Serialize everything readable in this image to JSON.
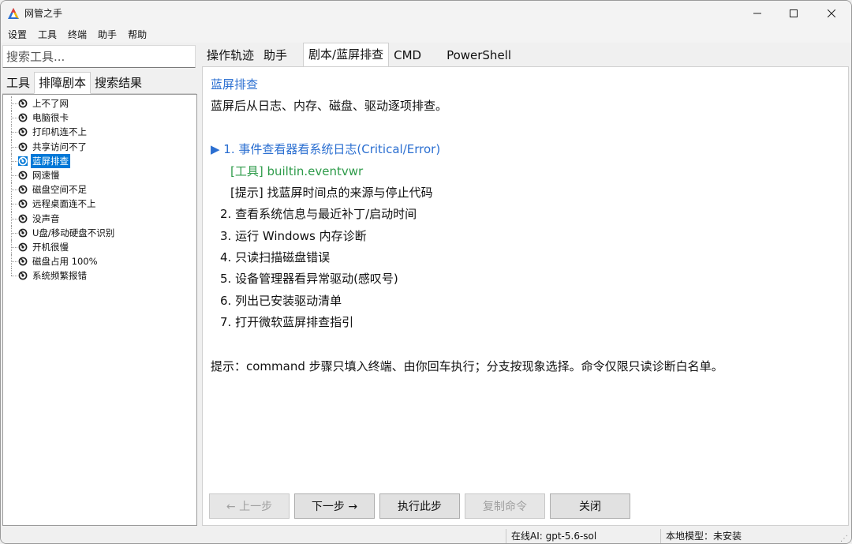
{
  "window": {
    "title": "网管之手",
    "brand_colors": {
      "icon_top": "#e03c3c",
      "icon_left": "#2b6fd1",
      "icon_right": "#f2b705"
    }
  },
  "menubar": {
    "items": [
      "设置",
      "工具",
      "终端",
      "助手",
      "帮助"
    ]
  },
  "left": {
    "search_placeholder": "搜索工具...",
    "tabs": [
      "工具",
      "排障剧本",
      "搜索结果"
    ],
    "active_tab": "排障剧本",
    "tree_items": [
      "上不了网",
      "电脑很卡",
      "打印机连不上",
      "共享访问不了",
      "蓝屏排查",
      "网速慢",
      "磁盘空间不足",
      "远程桌面连不上",
      "没声音",
      "U盘/移动硬盘不识别",
      "开机很慢",
      "磁盘占用 100%",
      "系统频繁报错"
    ],
    "selected_item": "蓝屏排查"
  },
  "right": {
    "tabs": [
      "操作轨迹",
      "助手",
      "剧本/蓝屏排查",
      "CMD",
      "PowerShell"
    ],
    "active_tab": "剧本/蓝屏排查",
    "playbook": {
      "title": "蓝屏排查",
      "description": "蓝屏后从日志、内存、磁盘、驱动逐项排查。",
      "steps": [
        {
          "text": "▶ 1. 事件查看器看系统日志(Critical/Error)",
          "kind": "active"
        },
        {
          "text": "[工具] builtin.eventvwr",
          "kind": "tool"
        },
        {
          "text": "[提示] 找蓝屏时间点的来源与停止代码",
          "kind": "note"
        },
        {
          "text": "2. 查看系统信息与最近补丁/启动时间",
          "kind": "normal"
        },
        {
          "text": "3. 运行 Windows 内存诊断",
          "kind": "normal"
        },
        {
          "text": "4. 只读扫描磁盘错误",
          "kind": "normal"
        },
        {
          "text": "5. 设备管理器看异常驱动(感叹号)",
          "kind": "normal"
        },
        {
          "text": "6. 列出已安装驱动清单",
          "kind": "normal"
        },
        {
          "text": "7. 打开微软蓝屏排查指引",
          "kind": "normal"
        }
      ],
      "hint": "提示：command 步骤只填入终端、由你回车执行；分支按现象选择。命令仅限只读诊断白名单。"
    },
    "buttons": {
      "prev": "← 上一步",
      "next": "下一步 →",
      "run": "执行此步",
      "copy": "复制命令",
      "close": "关闭"
    },
    "colors": {
      "link_blue": "#2b6fd1",
      "tool_green": "#2e9b4a",
      "selection": "#0078d7"
    }
  },
  "statusbar": {
    "ai": "在线AI:  gpt-5.6-sol",
    "local_model": "本地模型：未安装"
  }
}
